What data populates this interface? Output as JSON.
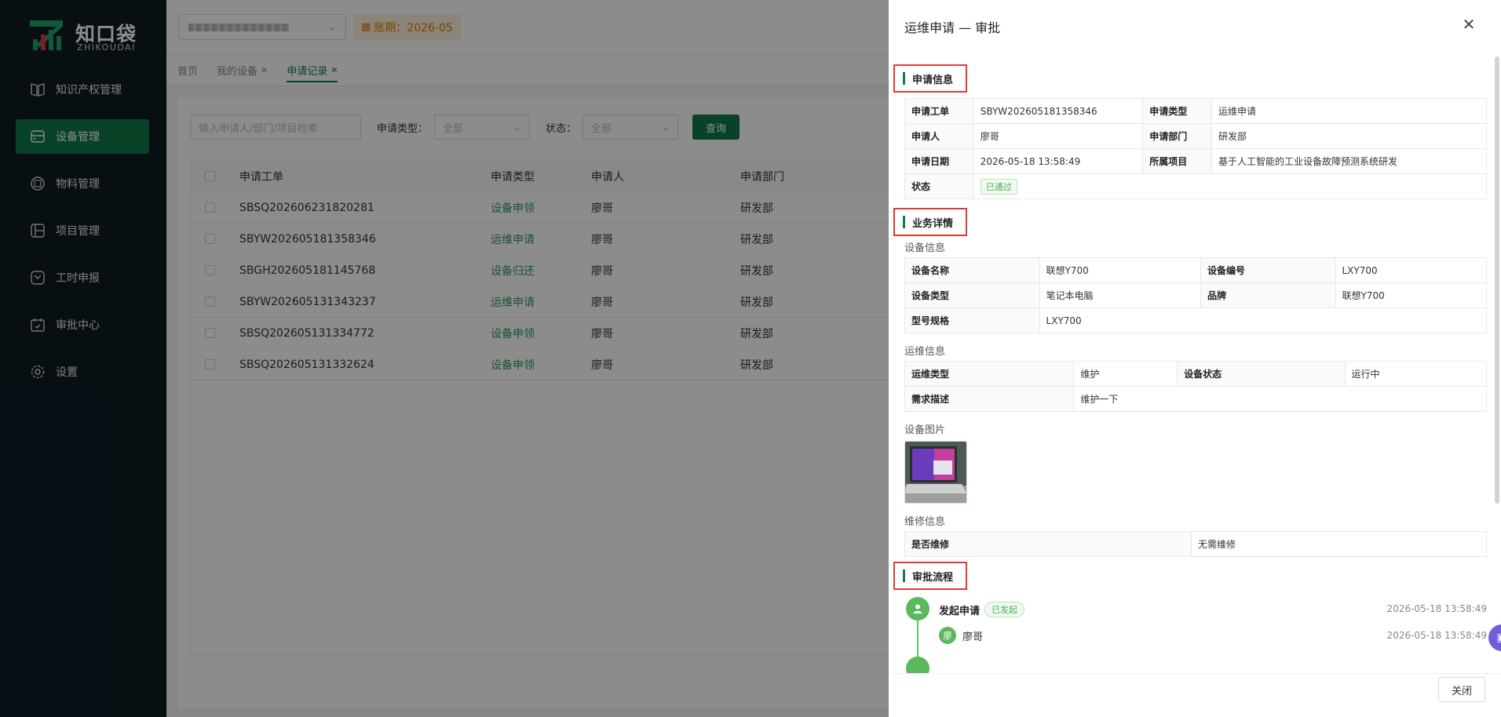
{
  "brand": {
    "name_cn": "知口袋",
    "name_en": "ZHIKOUDAI"
  },
  "sidebar": {
    "items": [
      {
        "label": "知识产权管理",
        "icon": "book-icon",
        "active": false
      },
      {
        "label": "设备管理",
        "icon": "device-icon",
        "active": true
      },
      {
        "label": "物料管理",
        "icon": "box-icon",
        "active": false
      },
      {
        "label": "项目管理",
        "icon": "project-icon",
        "active": false
      },
      {
        "label": "工时申报",
        "icon": "timesheet-icon",
        "active": false
      },
      {
        "label": "审批中心",
        "icon": "approval-icon",
        "active": false
      },
      {
        "label": "设置",
        "icon": "gear-icon",
        "active": false
      }
    ]
  },
  "topbar": {
    "period_label": "账期：2026-05"
  },
  "tabs": [
    {
      "label": "首页",
      "closable": false,
      "active": false
    },
    {
      "label": "我的设备",
      "closable": true,
      "active": false
    },
    {
      "label": "申请记录",
      "closable": true,
      "active": true
    }
  ],
  "filters": {
    "search_placeholder": "输入申请人/部门/项目检索",
    "type_label": "申请类型：",
    "type_value": "全部",
    "status_label": "状态：",
    "status_value": "全部",
    "query_button": "查询"
  },
  "table": {
    "headers": [
      "申请工单",
      "申请类型",
      "申请人",
      "申请部门"
    ],
    "rows": [
      [
        "SBSQ202606231820281",
        "设备申领",
        "廖哥",
        "研发部"
      ],
      [
        "SBYW202605181358346",
        "运维申请",
        "廖哥",
        "研发部"
      ],
      [
        "SBGH202605181145768",
        "设备归还",
        "廖哥",
        "研发部"
      ],
      [
        "SBYW202605131343237",
        "运维申请",
        "廖哥",
        "研发部"
      ],
      [
        "SBSQ202605131334772",
        "设备申领",
        "廖哥",
        "研发部"
      ],
      [
        "SBSQ202605131332624",
        "设备申领",
        "廖哥",
        "研发部"
      ]
    ]
  },
  "drawer": {
    "title": "运维申请 — 审批",
    "close_button": "关闭",
    "sections": {
      "apply_info": "申请信息",
      "business_detail": "业务详情",
      "approval_flow": "审批流程"
    },
    "apply_info": {
      "order_label": "申请工单",
      "order_value": "SBYW202605181358346",
      "type_label": "申请类型",
      "type_value": "运维申请",
      "applicant_label": "申请人",
      "applicant_value": "廖哥",
      "dept_label": "申请部门",
      "dept_value": "研发部",
      "date_label": "申请日期",
      "date_value": "2026-05-18 13:58:49",
      "project_label": "所属项目",
      "project_value": "基于人工智能的工业设备故障预测系统研发",
      "status_label": "状态",
      "status_value": "已通过"
    },
    "device_info": {
      "title": "设备信息",
      "name_label": "设备名称",
      "name_value": "联想Y700",
      "code_label": "设备编号",
      "code_value": "LXY700",
      "type_label": "设备类型",
      "type_value": "笔记本电脑",
      "brand_label": "品牌",
      "brand_value": "联想Y700",
      "model_label": "型号规格",
      "model_value": "LXY700"
    },
    "ops_info": {
      "title": "运维信息",
      "ops_type_label": "运维类型",
      "ops_type_value": "维护",
      "device_status_label": "设备状态",
      "device_status_value": "运行中",
      "desc_label": "需求描述",
      "desc_value": "维护一下"
    },
    "photo_title": "设备图片",
    "repair_info": {
      "title": "维修信息",
      "need_label": "是否维修",
      "need_value": "无需维修"
    },
    "flow": [
      {
        "step": "发起申请",
        "tag": "已发起",
        "time": "2026-05-18 13:58:49",
        "user": "廖哥",
        "user_avatar": "廖",
        "user_time": "2026-05-18 13:58:49"
      }
    ]
  },
  "colors": {
    "brand_green": "#0f7a4a",
    "link_green": "#2e9a5a",
    "highlight_red": "#e53935",
    "warning_orange": "#e07b00"
  }
}
